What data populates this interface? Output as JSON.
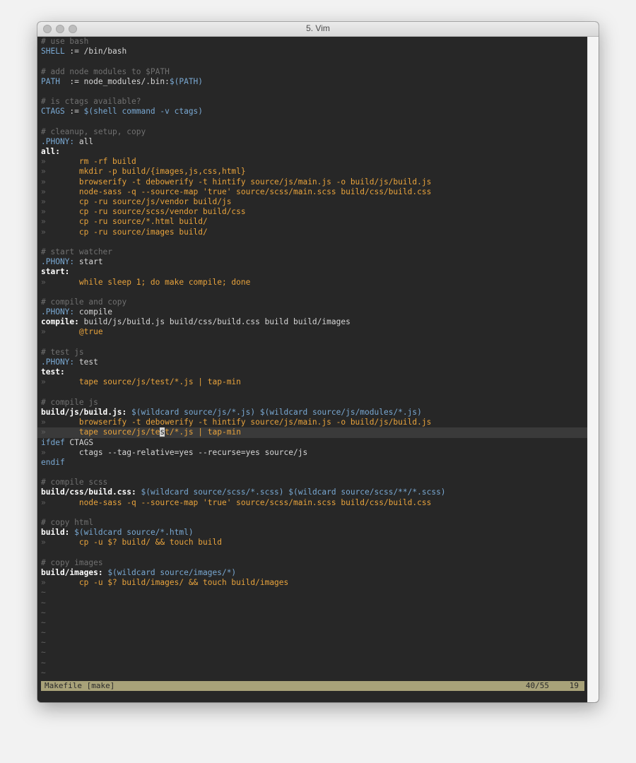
{
  "window": {
    "title": "5. Vim"
  },
  "editor": {
    "lines": [
      [
        {
          "t": "# use bash",
          "c": "comment"
        }
      ],
      [
        {
          "t": "SHELL",
          "c": "var"
        },
        {
          "t": " := /bin/bash",
          "c": "plain"
        }
      ],
      [],
      [
        {
          "t": "# add node modules to $PATH",
          "c": "comment"
        }
      ],
      [
        {
          "t": "PATH",
          "c": "var"
        },
        {
          "t": "  := node_modules/.bin:",
          "c": "plain"
        },
        {
          "t": "$(PATH)",
          "c": "var"
        }
      ],
      [],
      [
        {
          "t": "# is ctags available?",
          "c": "comment"
        }
      ],
      [
        {
          "t": "CTAGS",
          "c": "var"
        },
        {
          "t": " := ",
          "c": "plain"
        },
        {
          "t": "$(shell command -v ctags)",
          "c": "var"
        }
      ],
      [],
      [
        {
          "t": "# cleanup, setup, copy",
          "c": "comment"
        }
      ],
      [
        {
          "t": ".PHONY:",
          "c": "var"
        },
        {
          "t": " all",
          "c": "plain"
        }
      ],
      [
        {
          "t": "all:",
          "c": "target"
        }
      ],
      [
        {
          "t": "»",
          "c": "tab"
        },
        {
          "t": "       rm -rf build",
          "c": "cmd"
        }
      ],
      [
        {
          "t": "»",
          "c": "tab"
        },
        {
          "t": "       mkdir -p build/{images,js,css,html}",
          "c": "cmd"
        }
      ],
      [
        {
          "t": "»",
          "c": "tab"
        },
        {
          "t": "       browserify -t debowerify -t hintify source/js/main.js -o build/js/build.js",
          "c": "cmd"
        }
      ],
      [
        {
          "t": "»",
          "c": "tab"
        },
        {
          "t": "       node-sass -q --source-map 'true' source/scss/main.scss build/css/build.css",
          "c": "cmd"
        }
      ],
      [
        {
          "t": "»",
          "c": "tab"
        },
        {
          "t": "       cp -ru source/js/vendor build/js",
          "c": "cmd"
        }
      ],
      [
        {
          "t": "»",
          "c": "tab"
        },
        {
          "t": "       cp -ru source/scss/vendor build/css",
          "c": "cmd"
        }
      ],
      [
        {
          "t": "»",
          "c": "tab"
        },
        {
          "t": "       cp -ru source/*.html build/",
          "c": "cmd"
        }
      ],
      [
        {
          "t": "»",
          "c": "tab"
        },
        {
          "t": "       cp -ru source/images build/",
          "c": "cmd"
        }
      ],
      [],
      [
        {
          "t": "# start watcher",
          "c": "comment"
        }
      ],
      [
        {
          "t": ".PHONY:",
          "c": "var"
        },
        {
          "t": " start",
          "c": "plain"
        }
      ],
      [
        {
          "t": "start:",
          "c": "target"
        }
      ],
      [
        {
          "t": "»",
          "c": "tab"
        },
        {
          "t": "       while sleep 1; do make compile; done",
          "c": "cmd"
        }
      ],
      [],
      [
        {
          "t": "# compile and copy",
          "c": "comment"
        }
      ],
      [
        {
          "t": ".PHONY:",
          "c": "var"
        },
        {
          "t": " compile",
          "c": "plain"
        }
      ],
      [
        {
          "t": "compile:",
          "c": "target"
        },
        {
          "t": " build/js/build.js build/css/build.css build build/images",
          "c": "plain"
        }
      ],
      [
        {
          "t": "»",
          "c": "tab"
        },
        {
          "t": "       @true",
          "c": "cmd"
        }
      ],
      [],
      [
        {
          "t": "# test js",
          "c": "comment"
        }
      ],
      [
        {
          "t": ".PHONY:",
          "c": "var"
        },
        {
          "t": " test",
          "c": "plain"
        }
      ],
      [
        {
          "t": "test:",
          "c": "target"
        }
      ],
      [
        {
          "t": "»",
          "c": "tab"
        },
        {
          "t": "       tape source/js/test/*.js | tap-min",
          "c": "cmd"
        }
      ],
      [],
      [
        {
          "t": "# compile js",
          "c": "comment"
        }
      ],
      [
        {
          "t": "build/js/build.js:",
          "c": "target"
        },
        {
          "t": " ",
          "c": "plain"
        },
        {
          "t": "$(wildcard source/js/*.js) $(wildcard source/js/modules/*.js)",
          "c": "var"
        }
      ],
      [
        {
          "t": "»",
          "c": "tab"
        },
        {
          "t": "       browserify -t debowerify -t hintify source/js/main.js -o build/js/build.js",
          "c": "cmd"
        }
      ],
      [
        {
          "t": "»",
          "c": "tab"
        },
        {
          "t": "       tape source/js/te",
          "c": "cmd"
        },
        {
          "t": "s",
          "c": "cursor"
        },
        {
          "t": "t/*.js | tap-min",
          "c": "cmd"
        }
      ],
      [
        {
          "t": "ifdef",
          "c": "var"
        },
        {
          "t": " CTAGS",
          "c": "plain"
        }
      ],
      [
        {
          "t": "»",
          "c": "tab"
        },
        {
          "t": "       ctags --tag-relative=yes --recurse=yes source/js",
          "c": "plain"
        }
      ],
      [
        {
          "t": "endif",
          "c": "var"
        }
      ],
      [],
      [
        {
          "t": "# compile scss",
          "c": "comment"
        }
      ],
      [
        {
          "t": "build/css/build.css:",
          "c": "target"
        },
        {
          "t": " ",
          "c": "plain"
        },
        {
          "t": "$(wildcard source/scss/*.scss) $(wildcard source/scss/**/*.scss)",
          "c": "var"
        }
      ],
      [
        {
          "t": "»",
          "c": "tab"
        },
        {
          "t": "       node-sass -q --source-map 'true' source/scss/main.scss build/css/build.css",
          "c": "cmd"
        }
      ],
      [],
      [
        {
          "t": "# copy html",
          "c": "comment"
        }
      ],
      [
        {
          "t": "build:",
          "c": "target"
        },
        {
          "t": " ",
          "c": "plain"
        },
        {
          "t": "$(wildcard source/*.html)",
          "c": "var"
        }
      ],
      [
        {
          "t": "»",
          "c": "tab"
        },
        {
          "t": "       cp -u $? build/ && touch build",
          "c": "cmd"
        }
      ],
      [],
      [
        {
          "t": "# copy images",
          "c": "comment"
        }
      ],
      [
        {
          "t": "build/images:",
          "c": "target"
        },
        {
          "t": " ",
          "c": "plain"
        },
        {
          "t": "$(wildcard source/images/*)",
          "c": "var"
        }
      ],
      [
        {
          "t": "»",
          "c": "tab"
        },
        {
          "t": "       cp -u $? build/images/ && touch build/images",
          "c": "cmd"
        }
      ],
      [
        {
          "t": "~",
          "c": "tilde"
        }
      ],
      [
        {
          "t": "~",
          "c": "tilde"
        }
      ],
      [
        {
          "t": "~",
          "c": "tilde"
        }
      ],
      [
        {
          "t": "~",
          "c": "tilde"
        }
      ],
      [
        {
          "t": "~",
          "c": "tilde"
        }
      ],
      [
        {
          "t": "~",
          "c": "tilde"
        }
      ],
      [
        {
          "t": "~",
          "c": "tilde"
        }
      ],
      [
        {
          "t": "~",
          "c": "tilde"
        }
      ],
      [
        {
          "t": "~",
          "c": "tilde"
        }
      ]
    ],
    "current_line": 39
  },
  "statusline": {
    "file": "Makefile [make]",
    "position": "40/55",
    "column": "19"
  }
}
